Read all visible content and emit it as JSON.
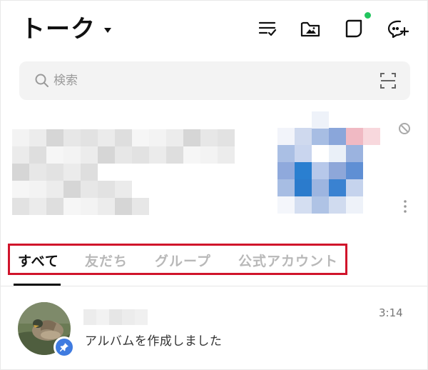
{
  "header": {
    "title": "トーク",
    "icons": [
      "checklist-icon",
      "album-folder-icon",
      "voom-icon",
      "new-chat-icon"
    ],
    "notification_color": "#22c55e"
  },
  "search": {
    "placeholder": "検索",
    "icon": "search-icon",
    "scan_icon": "qr-scan-icon"
  },
  "tabs": [
    {
      "label": "すべて",
      "active": true
    },
    {
      "label": "友だち",
      "active": false
    },
    {
      "label": "グループ",
      "active": false
    },
    {
      "label": "公式アカウント",
      "active": false
    }
  ],
  "highlight_color": "#d0142b",
  "chats": [
    {
      "last_message": "アルバムを作成しました",
      "time": "3:14",
      "pinned": true,
      "badge_color": "#3f7be0"
    }
  ]
}
